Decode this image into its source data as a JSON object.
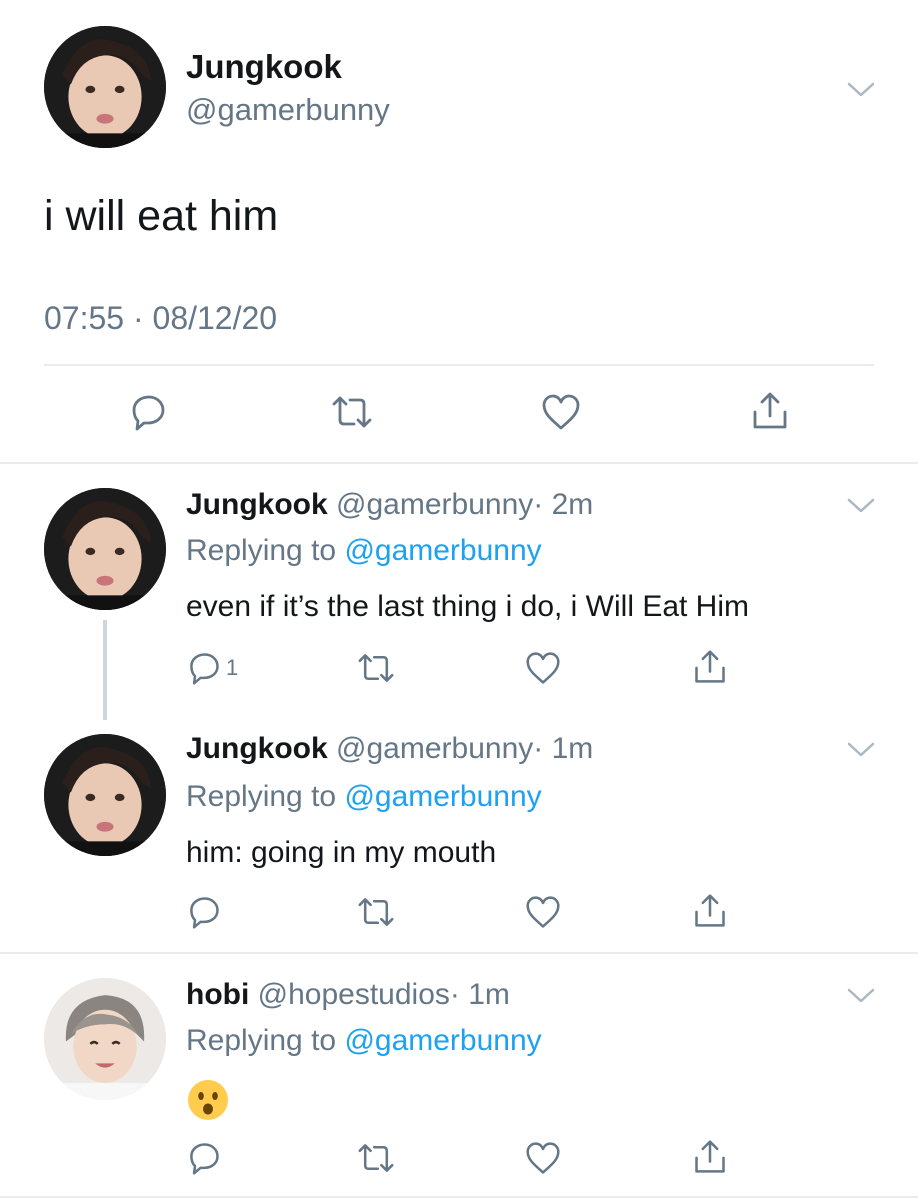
{
  "main_tweet": {
    "name": "Jungkook",
    "handle": "@gamerbunny",
    "text": "i will eat him",
    "timestamp": "07:55 · 08/12/20"
  },
  "replies": [
    {
      "name": "Jungkook",
      "handle": "@gamerbunny",
      "time": "· 2m",
      "replying_prefix": "Replying to ",
      "replying_to": "@gamerbunny",
      "text": "even if it’s the last thing i do, i Will Eat Him",
      "reply_count": "1"
    },
    {
      "name": "Jungkook",
      "handle": "@gamerbunny",
      "time": "· 1m",
      "replying_prefix": "Replying to ",
      "replying_to": "@gamerbunny",
      "text": "him: going in my mouth",
      "reply_count": ""
    },
    {
      "name": "hobi",
      "handle": "@hopestudios",
      "time": "· 1m",
      "replying_prefix": "Replying to ",
      "replying_to": "@gamerbunny",
      "text": "😦",
      "reply_count": ""
    }
  ],
  "colors": {
    "icon_gray": "#657786",
    "link_blue": "#1da1f2",
    "divider": "#e6ecf0",
    "emoji_yellow": "#ffcc4d"
  },
  "icons": [
    "chevron-down-icon",
    "reply-icon",
    "retweet-icon",
    "like-icon",
    "share-icon"
  ]
}
